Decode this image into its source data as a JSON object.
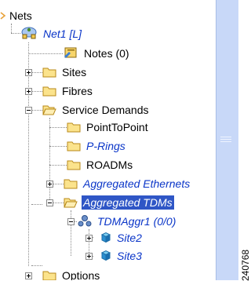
{
  "tree": {
    "root": "Nets",
    "net": "Net1 [L]",
    "notes": "Notes (0)",
    "sites": "Sites",
    "fibres": "Fibres",
    "service_demands": "Service Demands",
    "point_to_point": "PointToPoint",
    "p_rings": "P-Rings",
    "roadms": "ROADMs",
    "aggregated_ethernets": "Aggregated Ethernets",
    "aggregated_tdms": "Aggregated TDMs",
    "tdm_aggr": "TDMAggr1 (0/0)",
    "site2": "Site2",
    "site3": "Site3",
    "options": "Options"
  },
  "figure_id": "240768",
  "colors": {
    "link_blue": "#0a35c8",
    "selection": "#2f56c6",
    "folder_yellow": "#f2c94c",
    "scrollbar": "#c8d8f8"
  },
  "icons": {
    "net": "network-cloud-icon",
    "notes": "notes-icon",
    "folder": "folder-icon",
    "open_folder": "open-folder-icon",
    "tdm": "tdm-aggregation-icon",
    "site": "site-cube-icon"
  }
}
